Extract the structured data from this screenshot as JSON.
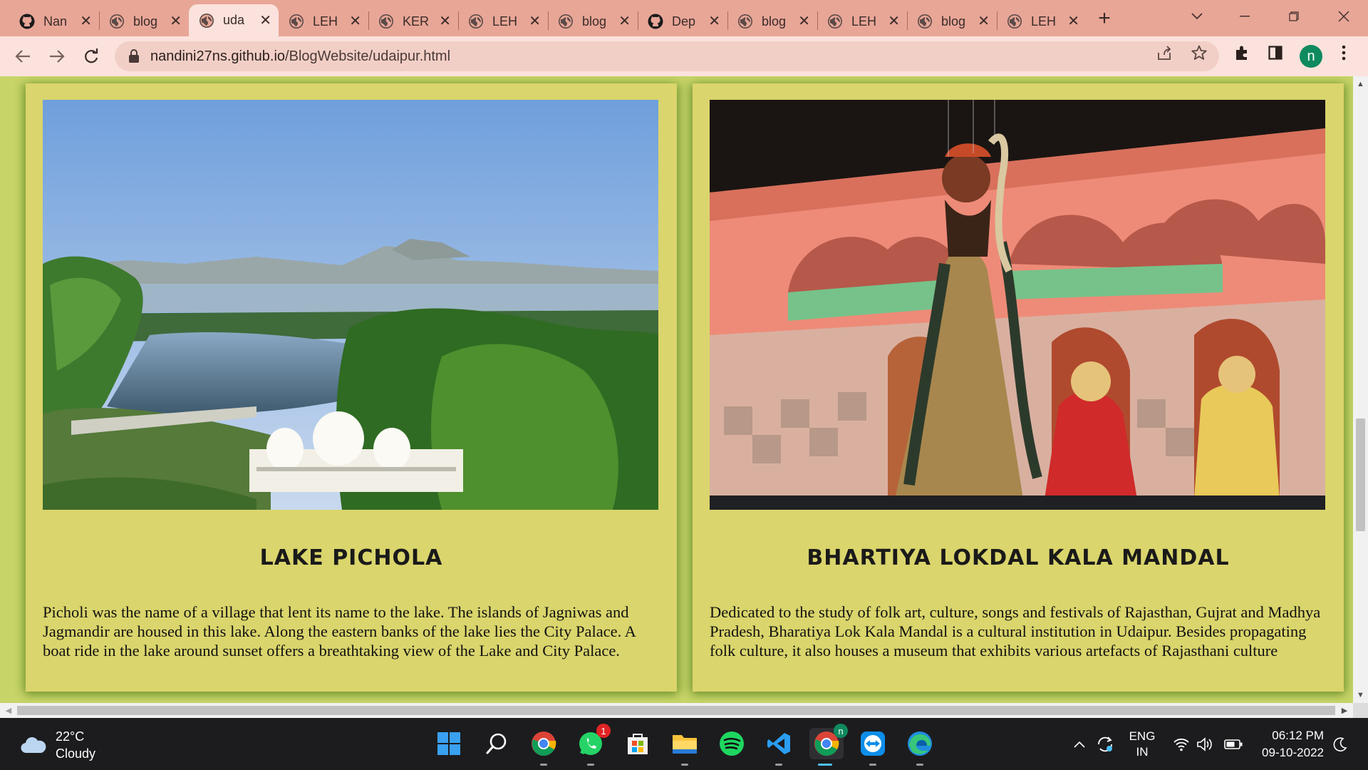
{
  "browser": {
    "tabs": [
      {
        "title": "Nan",
        "favicon": "github-icon"
      },
      {
        "title": "blog",
        "favicon": "globe-icon"
      },
      {
        "title": "uda",
        "favicon": "globe-icon",
        "active": true
      },
      {
        "title": "LEH",
        "favicon": "globe-icon"
      },
      {
        "title": "KER",
        "favicon": "globe-icon"
      },
      {
        "title": "LEH",
        "favicon": "globe-icon"
      },
      {
        "title": "blog",
        "favicon": "globe-icon"
      },
      {
        "title": "Dep",
        "favicon": "github-icon"
      },
      {
        "title": "blog",
        "favicon": "globe-icon"
      },
      {
        "title": "LEH",
        "favicon": "globe-icon"
      },
      {
        "title": "blog",
        "favicon": "globe-icon"
      },
      {
        "title": "LEH",
        "favicon": "globe-icon"
      }
    ],
    "address": {
      "host": "nandini27ns.github.io",
      "path": "/BlogWebsite/udaipur.html"
    },
    "profile_initial": "n",
    "theme_colors": {
      "frame": "#e8a697",
      "toolbar": "#fbe2dc",
      "omnibox": "#f2cfc6"
    }
  },
  "page": {
    "background": "#c7d468",
    "card_background": "#dad56c",
    "cards": [
      {
        "title": "LAKE PICHOLA",
        "image": "lake-pichola-photo",
        "text": "Picholi was the name of a village that lent its name to the lake. The islands of Jagniwas and Jagmandir are housed in this lake. Along the eastern banks of the lake lies the City Palace. A boat ride in the lake around sunset offers a breathtaking view of the Lake and City Palace."
      },
      {
        "title": "BHARTIYA LOKDAL KALA MANDAL",
        "image": "puppet-show-photo",
        "text": "Dedicated to the study of folk art, culture, songs and festivals of Rajasthan, Gujrat and Madhya Pradesh, Bharatiya Lok Kala Mandal is a cultural institution in Udaipur. Besides propagating folk culture, it also houses a museum that exhibits various artefacts of Rajasthani culture"
      }
    ]
  },
  "taskbar": {
    "weather": {
      "temp": "22°C",
      "condition": "Cloudy"
    },
    "apps": [
      "start-icon",
      "search-icon",
      "chrome-icon",
      "whatsapp-icon",
      "store-icon",
      "file-explorer-icon",
      "spotify-icon",
      "vscode-icon",
      "chrome-profile-icon",
      "teamviewer-icon",
      "edge-icon"
    ],
    "whatsapp_badge": "1",
    "chrome_profile_badge": "n",
    "language": {
      "line1": "ENG",
      "line2": "IN"
    },
    "clock": {
      "time": "06:12 PM",
      "date": "09-10-2022"
    }
  }
}
